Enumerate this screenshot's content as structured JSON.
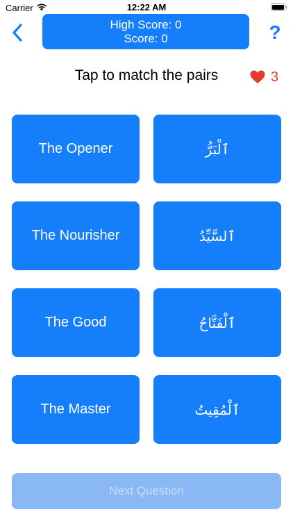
{
  "status_bar": {
    "carrier": "Carrier",
    "time": "12:22 AM",
    "icons": [
      "wifi-icon",
      "battery-icon"
    ]
  },
  "header": {
    "back_icon": "chevron-left-icon",
    "high_score": "High Score: 0",
    "score": "Score: 0",
    "help_label": "?"
  },
  "game": {
    "instruction": "Tap to match the pairs",
    "lives": "3",
    "lives_icon": "heart-icon",
    "left_tiles": [
      "The Opener",
      "The Nourisher",
      "The Good",
      "The Master"
    ],
    "right_tiles": [
      "ٱلْبَرُّ",
      "ٱلسَّيِّدُ",
      "ٱلْفَتَّاحُ",
      "ٱلْمُقِيتُ"
    ]
  },
  "footer": {
    "next_label": "Next Question",
    "next_enabled": false
  },
  "colors": {
    "accent": "#157efb",
    "heart": "#e53a2f",
    "disabled_button": "#8ab8f5"
  }
}
